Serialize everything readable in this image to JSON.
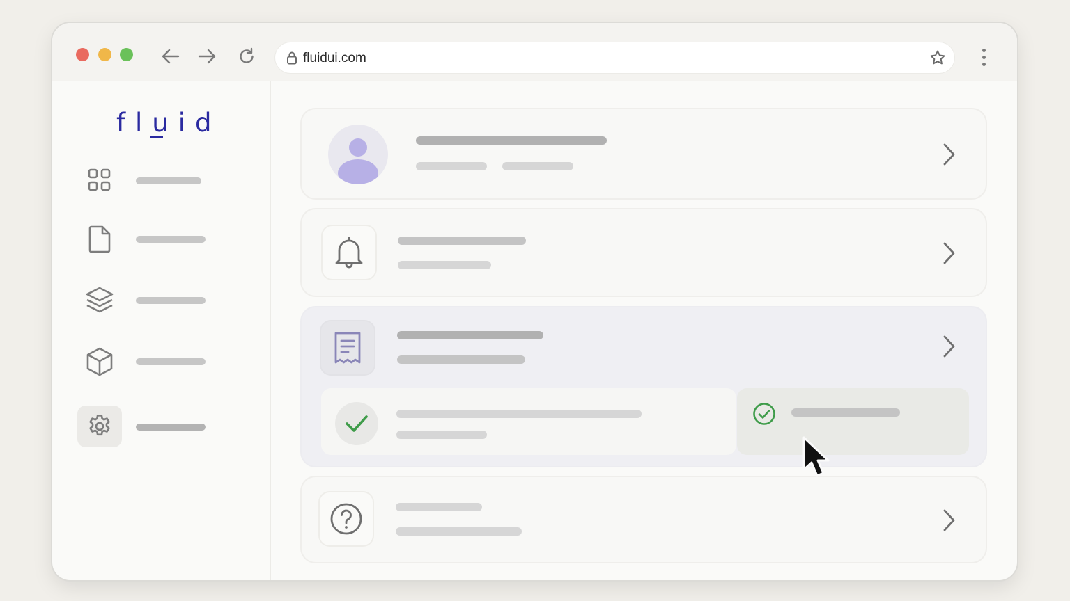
{
  "browser": {
    "url": "fluidui.com",
    "traffic_lights": {
      "red": "#e96a5f",
      "yellow": "#f0b749",
      "green": "#6ac15a"
    },
    "icons": [
      "back-arrow-icon",
      "forward-arrow-icon",
      "reload-icon",
      "lock-icon",
      "star-icon",
      "kebab-menu-icon"
    ]
  },
  "sidebar": {
    "logo": "fluid",
    "items": [
      {
        "icon": "grid-icon",
        "active": false
      },
      {
        "icon": "document-icon",
        "active": false
      },
      {
        "icon": "layers-icon",
        "active": false
      },
      {
        "icon": "cube-icon",
        "active": false
      },
      {
        "icon": "gear-icon",
        "active": true
      }
    ]
  },
  "main": {
    "cards": [
      {
        "icon": "user-avatar-icon",
        "chevron": "chevron-right-icon"
      },
      {
        "icon": "bell-icon",
        "chevron": "chevron-right-icon"
      },
      {
        "icon": "receipt-icon",
        "chevron": "chevron-right-icon",
        "expanded": true,
        "subitems": [
          {
            "icon": "check-icon"
          },
          {
            "icon": "check-circle-icon"
          }
        ]
      },
      {
        "icon": "help-circle-icon",
        "chevron": "chevron-right-icon"
      }
    ]
  },
  "colors": {
    "accent": "#2a2aa0",
    "avatar": "#b7b0e6",
    "success": "#3f9c4a"
  }
}
